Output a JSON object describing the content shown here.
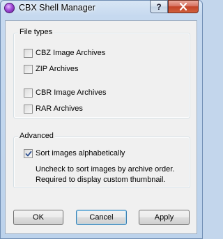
{
  "window": {
    "title": "CBX Shell Manager",
    "help_label": "?",
    "close_label": "X"
  },
  "file_types": {
    "label": "File types",
    "options": [
      {
        "label": "CBZ Image Archives",
        "checked": false
      },
      {
        "label": "ZIP Archives",
        "checked": false
      },
      {
        "label": "CBR Image Archives",
        "checked": false
      },
      {
        "label": "RAR Archives",
        "checked": false
      }
    ]
  },
  "advanced": {
    "label": "Advanced",
    "sort_option": {
      "label": "Sort images alphabetically",
      "checked": true
    },
    "note_line1": "Uncheck to sort images by archive order.",
    "note_line2": "Required to display custom thumbnail."
  },
  "buttons": {
    "ok": "OK",
    "cancel": "Cancel",
    "apply": "Apply"
  }
}
